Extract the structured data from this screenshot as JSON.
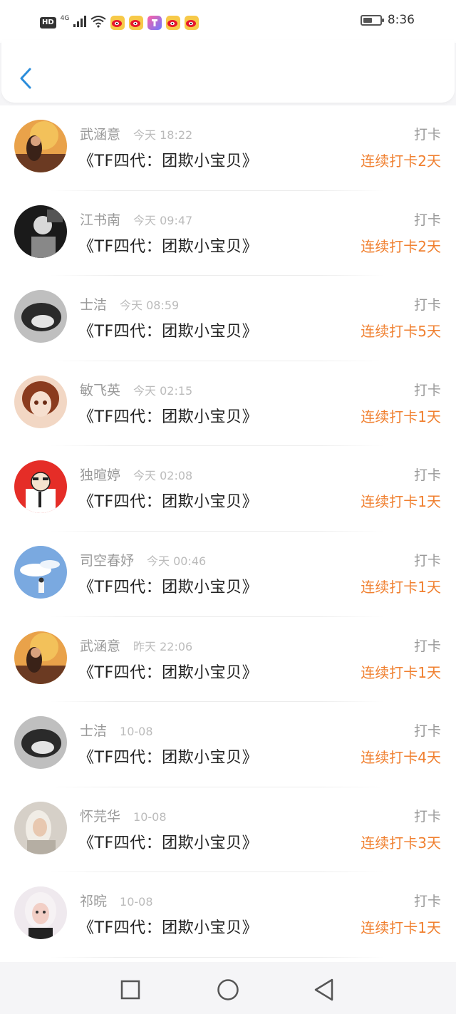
{
  "status_bar": {
    "hd_label": "HD",
    "network_label": "4G",
    "time": "8:36",
    "battery_level": 0.55,
    "notification_icons": [
      "weibo-icon",
      "weibo-icon",
      "app-icon",
      "weibo-icon",
      "weibo-icon"
    ]
  },
  "header": {
    "back_icon": "chevron-left-icon",
    "accent_color": "#2b8ddb"
  },
  "colors": {
    "streak": "#f08030",
    "name": "#999999",
    "time": "#bbbbbb",
    "title": "#222222"
  },
  "records": [
    {
      "name": "武涵意",
      "time": "今天 18:22",
      "title": "《TF四代：团欺小宝贝》",
      "type": "打卡",
      "streak": "连续打卡2天"
    },
    {
      "name": "江书南",
      "time": "今天 09:47",
      "title": "《TF四代：团欺小宝贝》",
      "type": "打卡",
      "streak": "连续打卡2天"
    },
    {
      "name": "士洁",
      "time": "今天 08:59",
      "title": "《TF四代：团欺小宝贝》",
      "type": "打卡",
      "streak": "连续打卡5天"
    },
    {
      "name": "敏飞英",
      "time": "今天 02:15",
      "title": "《TF四代：团欺小宝贝》",
      "type": "打卡",
      "streak": "连续打卡1天"
    },
    {
      "name": "独暄婷",
      "time": "今天 02:08",
      "title": "《TF四代：团欺小宝贝》",
      "type": "打卡",
      "streak": "连续打卡1天"
    },
    {
      "name": "司空春妤",
      "time": "今天 00:46",
      "title": "《TF四代：团欺小宝贝》",
      "type": "打卡",
      "streak": "连续打卡1天"
    },
    {
      "name": "武涵意",
      "time": "昨天 22:06",
      "title": "《TF四代：团欺小宝贝》",
      "type": "打卡",
      "streak": "连续打卡1天"
    },
    {
      "name": "士洁",
      "time": "10-08",
      "title": "《TF四代：团欺小宝贝》",
      "type": "打卡",
      "streak": "连续打卡4天"
    },
    {
      "name": "怀芫华",
      "time": "10-08",
      "title": "《TF四代：团欺小宝贝》",
      "type": "打卡",
      "streak": "连续打卡3天"
    },
    {
      "name": "祁晥",
      "time": "10-08",
      "title": "《TF四代：团欺小宝贝》",
      "type": "打卡",
      "streak": "连续打卡1天"
    }
  ],
  "nav_bar": {
    "buttons": [
      "recent-apps-icon",
      "home-icon",
      "back-triangle-icon"
    ]
  }
}
